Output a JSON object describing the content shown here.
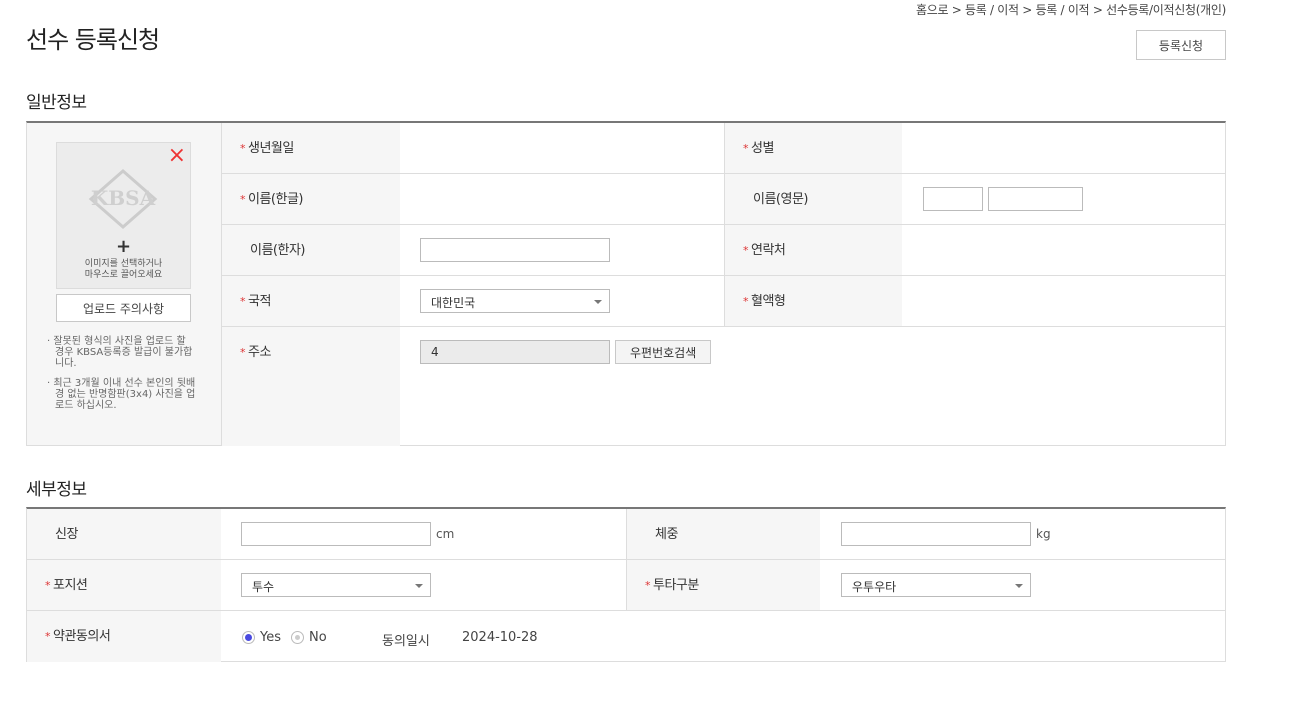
{
  "breadcrumb": "홈으로 > 등록 / 이적 > 등록 / 이적 > 선수등록/이적신청(개인)",
  "page_title": "선수 등록신청",
  "register_button": "등록신청",
  "general_section": {
    "title": "일반정보",
    "photo": {
      "hint_line1": "이미지를 선택하거나",
      "hint_line2": "마우스로 끌어오세요",
      "plus": "+",
      "close": "×",
      "logo_text": "KBSA",
      "upload_notice_button": "업로드 주의사항",
      "notice1": "· 잘못된 형식의 사진을 업로드 할 경우 KBSA등록증 발급이 불가합니다.",
      "notice2": "· 최근 3개월 이내 선수 본인의 뒷배경 없는 반명함판(3x4) 사진을 업로드 하십시오."
    },
    "fields": {
      "birth": {
        "label": "생년월일",
        "value": ""
      },
      "gender": {
        "label": "성별",
        "value": ""
      },
      "name_kr": {
        "label": "이름(한글)",
        "value": ""
      },
      "name_en": {
        "label": "이름(영문)",
        "first": "",
        "last": ""
      },
      "name_hanja": {
        "label": "이름(한자)",
        "value": ""
      },
      "contact": {
        "label": "연락처",
        "value": ""
      },
      "nationality": {
        "label": "국적",
        "selected": "대한민국"
      },
      "blood": {
        "label": "혈액형",
        "value": ""
      },
      "address": {
        "label": "주소",
        "zip_value": "4",
        "zip_button": "우편번호검색"
      }
    }
  },
  "detail_section": {
    "title": "세부정보",
    "height": {
      "label": "신장",
      "value": "",
      "unit": "cm"
    },
    "weight": {
      "label": "체중",
      "value": "",
      "unit": "kg"
    },
    "position": {
      "label": "포지션",
      "selected": "투수"
    },
    "bat_throw": {
      "label": "투타구분",
      "selected": "우투우타"
    },
    "terms": {
      "label": "약관동의서",
      "yes": "Yes",
      "no": "No",
      "selected": "Yes",
      "date_label": "동의일시",
      "date": "2024-10-28"
    }
  },
  "colors": {
    "required": "#dd3333",
    "radio_selected": "#4a4ae0",
    "close_icon": "#ee3333"
  }
}
